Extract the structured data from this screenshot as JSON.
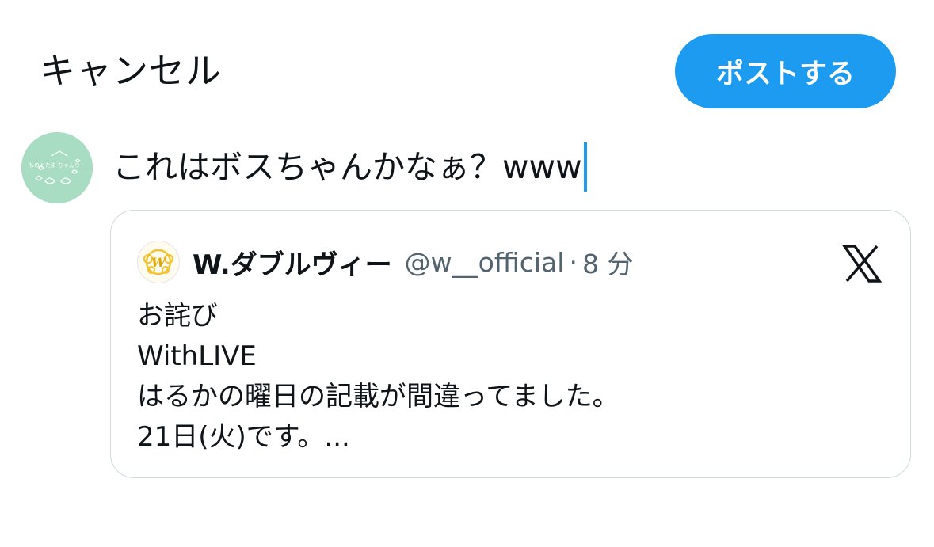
{
  "header": {
    "cancel_label": "キャンセル",
    "post_label": "ポストする"
  },
  "composer": {
    "text": "これはボスちゃんかなぁ？www",
    "avatar_text": "ものとたま ちゃんりー"
  },
  "quote": {
    "display_name": "W.ダブルヴィー",
    "handle": "@w__official",
    "separator": "·",
    "time": "8 分",
    "avatar_logo_text": "W",
    "lines": [
      "お詫び",
      "WithLIVE",
      "はるかの曜日の記載が間違ってました。",
      "21日(火)です。..."
    ]
  },
  "colors": {
    "accent": "#1d9bf0",
    "text": "#0f1419",
    "secondary_text": "#536471",
    "border": "#cfd9de",
    "avatar_bg": "#a8dcc3"
  },
  "icons": {
    "quote_source": "x-logo-icon"
  }
}
